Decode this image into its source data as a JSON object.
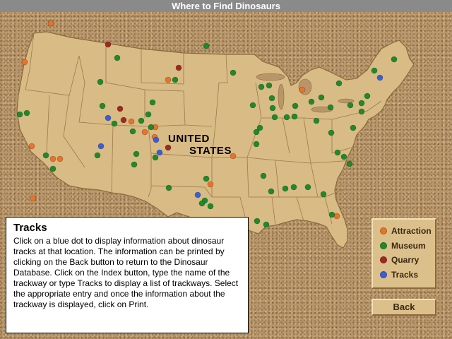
{
  "window": {
    "title": "Where to Find Dinosaurs"
  },
  "map": {
    "country_label_line1": "UNITED",
    "country_label_line2": "STATES",
    "colors": {
      "land": "#d9bb85",
      "border": "#9c7a4a",
      "sand": "#b8966a"
    },
    "icons": [
      "map-of-united-states"
    ]
  },
  "info": {
    "title": "Tracks",
    "body": "Click on a blue dot to display information about dinosaur tracks at that location. The information can be printed by clicking on the Back button to return to the Dinosaur Database. Click on the Index button, type the name of the trackway or type Tracks to display a list of trackways. Select the appropriate entry and once the information about the trackway is displayed, click on Print."
  },
  "legend": {
    "items": [
      {
        "label": "Attraction",
        "color": "#e8742a"
      },
      {
        "label": "Museum",
        "color": "#1e8a2a"
      },
      {
        "label": "Quarry",
        "color": "#a02820"
      },
      {
        "label": "Tracks",
        "color": "#3a5ed8"
      }
    ]
  },
  "buttons": {
    "back": "Back"
  }
}
